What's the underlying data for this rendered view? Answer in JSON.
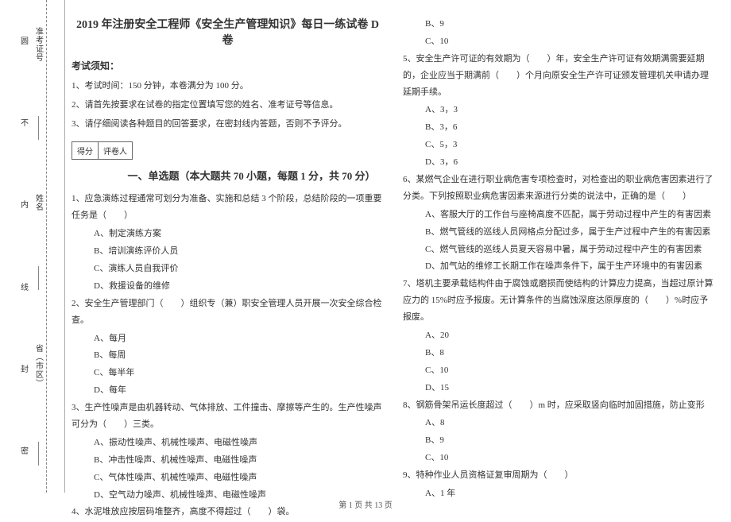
{
  "binding": {
    "markers": [
      "密",
      "封",
      "线",
      "内",
      "不"
    ],
    "fields": [
      "省（市区）",
      "姓名",
      "准考证号"
    ],
    "circle": "圆"
  },
  "header": {
    "title": "2019 年注册安全工程师《安全生产管理知识》每日一练试卷 D 卷",
    "notice_label": "考试须知：",
    "instructions": [
      "1、考试时间：150 分钟，本卷满分为 100 分。",
      "2、请首先按要求在试卷的指定位置填写您的姓名、准考证号等信息。",
      "3、请仔细阅读各种题目的回答要求，在密封线内答题，否则不予评分。"
    ],
    "score_labels": [
      "得分",
      "评卷人"
    ]
  },
  "section1": {
    "title": "一、单选题（本大题共 70 小题，每题 1 分，共 70 分）"
  },
  "questions_left": [
    {
      "stem": "1、应急演练过程通常可划分为准备、实施和总结 3 个阶段，总结阶段的一项重要任务是（　　）",
      "opts": [
        "A、制定演练方案",
        "B、培训演练评价人员",
        "C、演练人员自我评价",
        "D、救援设备的维修"
      ]
    },
    {
      "stem": "2、安全生产管理部门（　　）组织专（兼）职安全管理人员开展一次安全综合检查。",
      "opts": [
        "A、每月",
        "B、每周",
        "C、每半年",
        "D、每年"
      ]
    },
    {
      "stem": "3、生产性噪声是由机器转动、气体排放、工件撞击、摩擦等产生的。生产性噪声可分为（　　）三类。",
      "opts": [
        "A、振动性噪声、机械性噪声、电磁性噪声",
        "B、冲击性噪声、机械性噪声、电磁性噪声",
        "C、气体性噪声、机械性噪声、电磁性噪声",
        "D、空气动力噪声、机械性噪声、电磁性噪声"
      ]
    },
    {
      "stem": "4、水泥堆放应按层码堆整齐，高度不得超过（　　）袋。",
      "opts": []
    }
  ],
  "questions_right_pre": [
    "B、9",
    "C、10"
  ],
  "questions_right": [
    {
      "stem": "5、安全生产许可证的有效期为（　　）年，安全生产许可证有效期满需要延期的，企业应当于期满前（　　）个月向原安全生产许可证颁发管理机关申请办理延期手续。",
      "opts": [
        "A、3，3",
        "B、3，6",
        "C、5，3",
        "D、3，6"
      ]
    },
    {
      "stem": "6、某燃气企业在进行职业病危害专项检查时，对检查出的职业病危害因素进行了分类。下列按照职业病危害因素来源进行分类的说法中，正确的是（　　）",
      "opts": [
        "A、客服大厅的工作台与座椅高度不匹配，属于劳动过程中产生的有害因素",
        "B、燃气管线的巡线人员网格点分配过多，属于生产过程中产生的有害因素",
        "C、燃气管线的巡线人员夏天容易中暑，属于劳动过程中产生的有害因素",
        "D、加气站的维修工长期工作在噪声条件下，属于生产环境中的有害因素"
      ]
    },
    {
      "stem": "7、塔机主要承载结构件由于腐蚀或磨损而使结构的计算应力提高，当超过原计算应力的 15%时应予报废。无计算条件的当腐蚀深度达原厚度的（　　）%时应予报废。",
      "opts": [
        "A、20",
        "B、8",
        "C、10",
        "D、15"
      ]
    },
    {
      "stem": "8、钢筋骨架吊运长度超过（　　）m 时，应采取竖向临时加固措施，防止变形",
      "opts": [
        "A、8",
        "B、9",
        "C、10"
      ]
    },
    {
      "stem": "9、特种作业人员资格证复审周期为（　　）",
      "opts": [
        "A、1 年"
      ]
    }
  ],
  "footer": "第 1 页 共 13 页"
}
